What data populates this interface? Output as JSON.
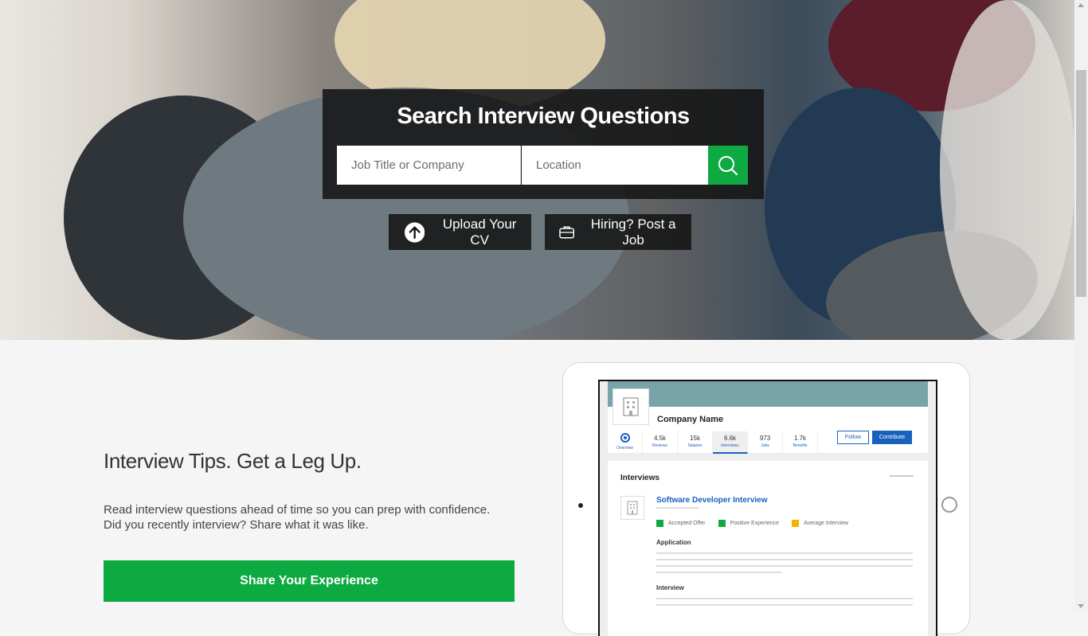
{
  "hero": {
    "title": "Search Interview Questions",
    "job_placeholder": "Job Title or Company",
    "location_placeholder": "Location",
    "upload_label": "Upload Your CV",
    "post_label": "Hiring? Post a Job"
  },
  "tips": {
    "title": "Interview Tips. Get a Leg Up.",
    "line1": "Read interview questions ahead of time so you can prep with confidence.",
    "line2": "Did you recently interview? Share what it was like.",
    "share_label": "Share Your Experience"
  },
  "preview": {
    "company_name": "Company Name",
    "stats": [
      {
        "value": "",
        "label": "Overview"
      },
      {
        "value": "4.5k",
        "label": "Reviews"
      },
      {
        "value": "15k",
        "label": "Salaries"
      },
      {
        "value": "6.6k",
        "label": "Interviews"
      },
      {
        "value": "973",
        "label": "Jobs"
      },
      {
        "value": "1.7k",
        "label": "Benefits"
      }
    ],
    "follow_label": "Follow",
    "contribute_label": "Contribute",
    "interviews_heading": "Interviews",
    "job_title": "Software Developer Interview",
    "tags": [
      {
        "label": "Accepted Offer",
        "color": "#0caa41"
      },
      {
        "label": "Positive Experience",
        "color": "#0caa41"
      },
      {
        "label": "Average Interview",
        "color": "#f5b400"
      }
    ],
    "application_heading": "Application",
    "interview_heading": "Interview"
  },
  "colors": {
    "brand_green": "#0caa41",
    "link_blue": "#1861bf"
  }
}
